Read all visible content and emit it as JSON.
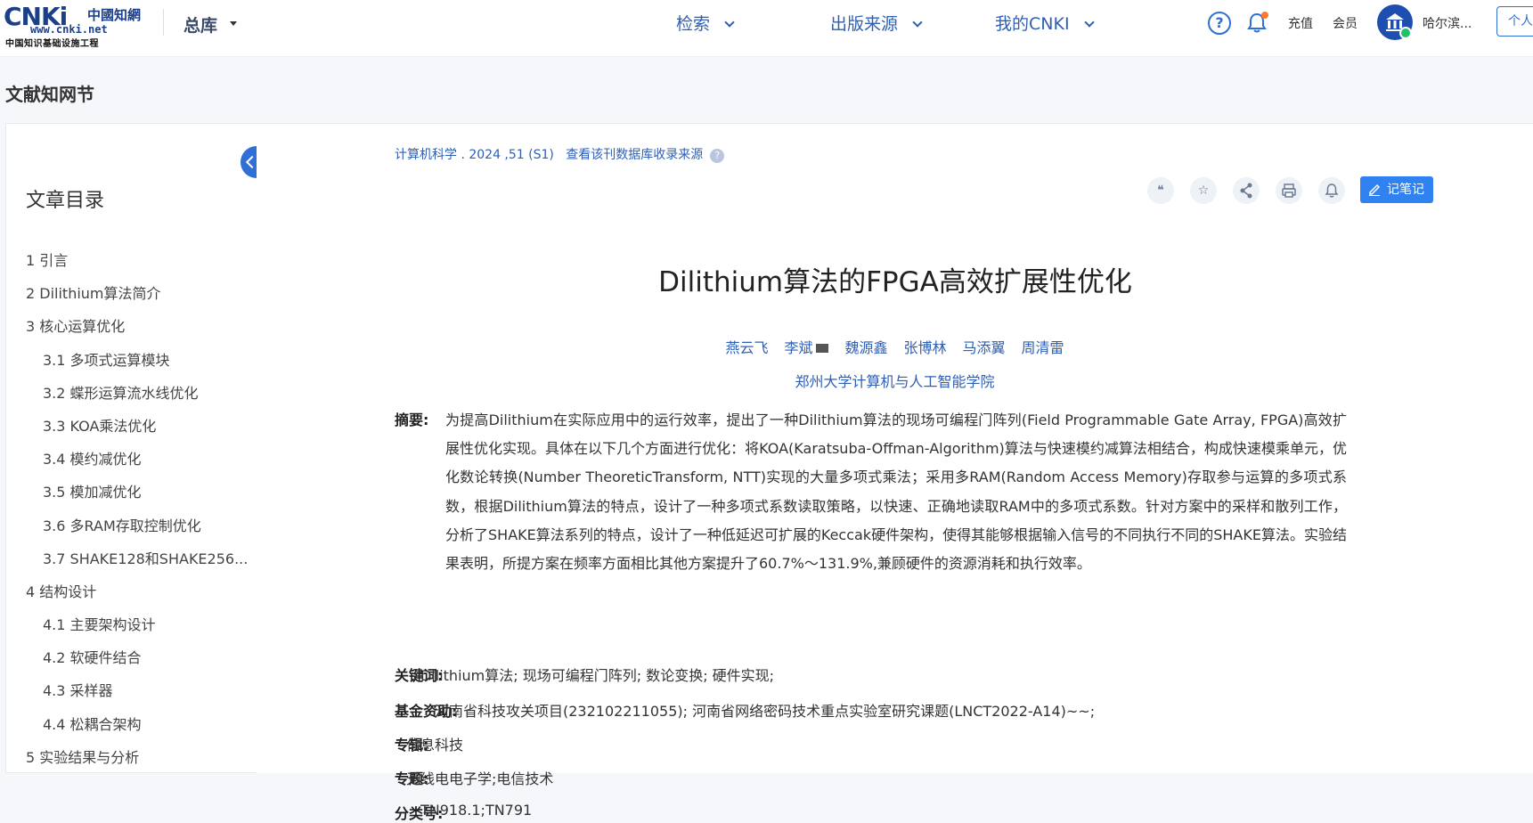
{
  "header": {
    "logo_main": "CNKi",
    "logo_cn": "中國知網",
    "logo_url": "www.cnki.net",
    "logo_tagline": "中国知识基础设施工程",
    "database": "总库",
    "nav": [
      "检索",
      "出版来源",
      "我的CNKI"
    ],
    "recharge": "充值",
    "member": "会员",
    "user": "哈尔滨...",
    "personal": "个人"
  },
  "page": {
    "section_title": "文献知网节"
  },
  "toc": {
    "heading": "文章目录",
    "items": [
      {
        "label": "1 引言",
        "sub": false
      },
      {
        "label": "2 Dilithium算法简介",
        "sub": false
      },
      {
        "label": "3 核心运算优化",
        "sub": false
      },
      {
        "label": "3.1 多项式运算模块",
        "sub": true
      },
      {
        "label": "3.2 蝶形运算流水线优化",
        "sub": true
      },
      {
        "label": "3.3 KOA乘法优化",
        "sub": true
      },
      {
        "label": "3.4 模约减优化",
        "sub": true
      },
      {
        "label": "3.5 模加减优化",
        "sub": true
      },
      {
        "label": "3.6 多RAM存取控制优化",
        "sub": true
      },
      {
        "label": "3.7 SHAKE128和SHAKE256...",
        "sub": true
      },
      {
        "label": "4 结构设计",
        "sub": false
      },
      {
        "label": "4.1 主要架构设计",
        "sub": true
      },
      {
        "label": "4.2 软硬件结合",
        "sub": true
      },
      {
        "label": "4.3 采样器",
        "sub": true
      },
      {
        "label": "4.4 松耦合架构",
        "sub": true
      },
      {
        "label": "5 实验结果与分析",
        "sub": false
      }
    ]
  },
  "article": {
    "source": "计算机科学 . 2024 ,51 (S1)",
    "source_link": "查看该刊数据库收录来源",
    "toolbar_note": "记笔记",
    "title": "Dilithium算法的FPGA高效扩展性优化",
    "authors": [
      "燕云飞",
      "李斌",
      "魏源鑫",
      "张博林",
      "马添翼",
      "周清雷"
    ],
    "affiliation": "郑州大学计算机与人工智能学院",
    "abstract_label": "摘要:",
    "abstract": "为提高Dilithium在实际应用中的运行效率，提出了一种Dilithium算法的现场可编程门阵列(Field Programmable Gate Array, FPGA)高效扩展性优化实现。具体在以下几个方面进行优化：将KOA(Karatsuba-Offman-Algorithm)算法与快速模约减算法相结合，构成快速模乘单元，优化数论转换(Number TheoreticTransform, NTT)实现的大量多项式乘法；采用多RAM(Random Access Memory)存取参与运算的多项式系数，根据Dilithium算法的特点，设计了一种多项式系数读取策略，以快速、正确地读取RAM中的多项式系数。针对方案中的采样和散列工作，分析了SHAKE算法系列的特点，设计了一种低延迟可扩展的Keccak硬件架构，使得其能够根据输入信号的不同执行不同的SHAKE算法。实验结果表明，所提方案在频率方面相比其他方案提升了60.7%～131.9%,兼顾硬件的资源消耗和执行效率。",
    "keywords_label": "关键词:",
    "keywords": "Dilithium算法;  现场可编程门阵列;  数论变换;  硬件实现;",
    "fund_label": "基金资助:",
    "fund": "河南省科技攻关项目(232102211055);   河南省网络密码技术重点实验室研究课题(LNCT2022-A14)~~;",
    "series_label": "专辑:",
    "series": "信息科技",
    "topic_label": "专题:",
    "topic": "无线电电子学;电信技术",
    "class_label": "分类号:",
    "class": "TN918.1;TN791"
  },
  "colors": {
    "accent": "#2f6fd6",
    "link": "#2f5fb3",
    "note_button": "#2f82f0"
  }
}
